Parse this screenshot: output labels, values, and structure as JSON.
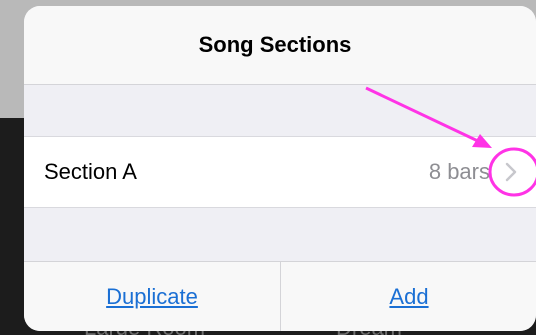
{
  "popover": {
    "title": "Song Sections"
  },
  "sections": [
    {
      "label": "Section A",
      "detail": "8 bars",
      "accessory": "chevron-right-icon"
    }
  ],
  "toolbar": {
    "duplicate_label": "Duplicate",
    "add_label": "Add"
  },
  "background": {
    "left_text": "Large Room",
    "right_text": "Dream"
  },
  "colors": {
    "link": "#1a6fd4",
    "annotation": "#ff33e6",
    "detail_text": "#8e8e93"
  }
}
